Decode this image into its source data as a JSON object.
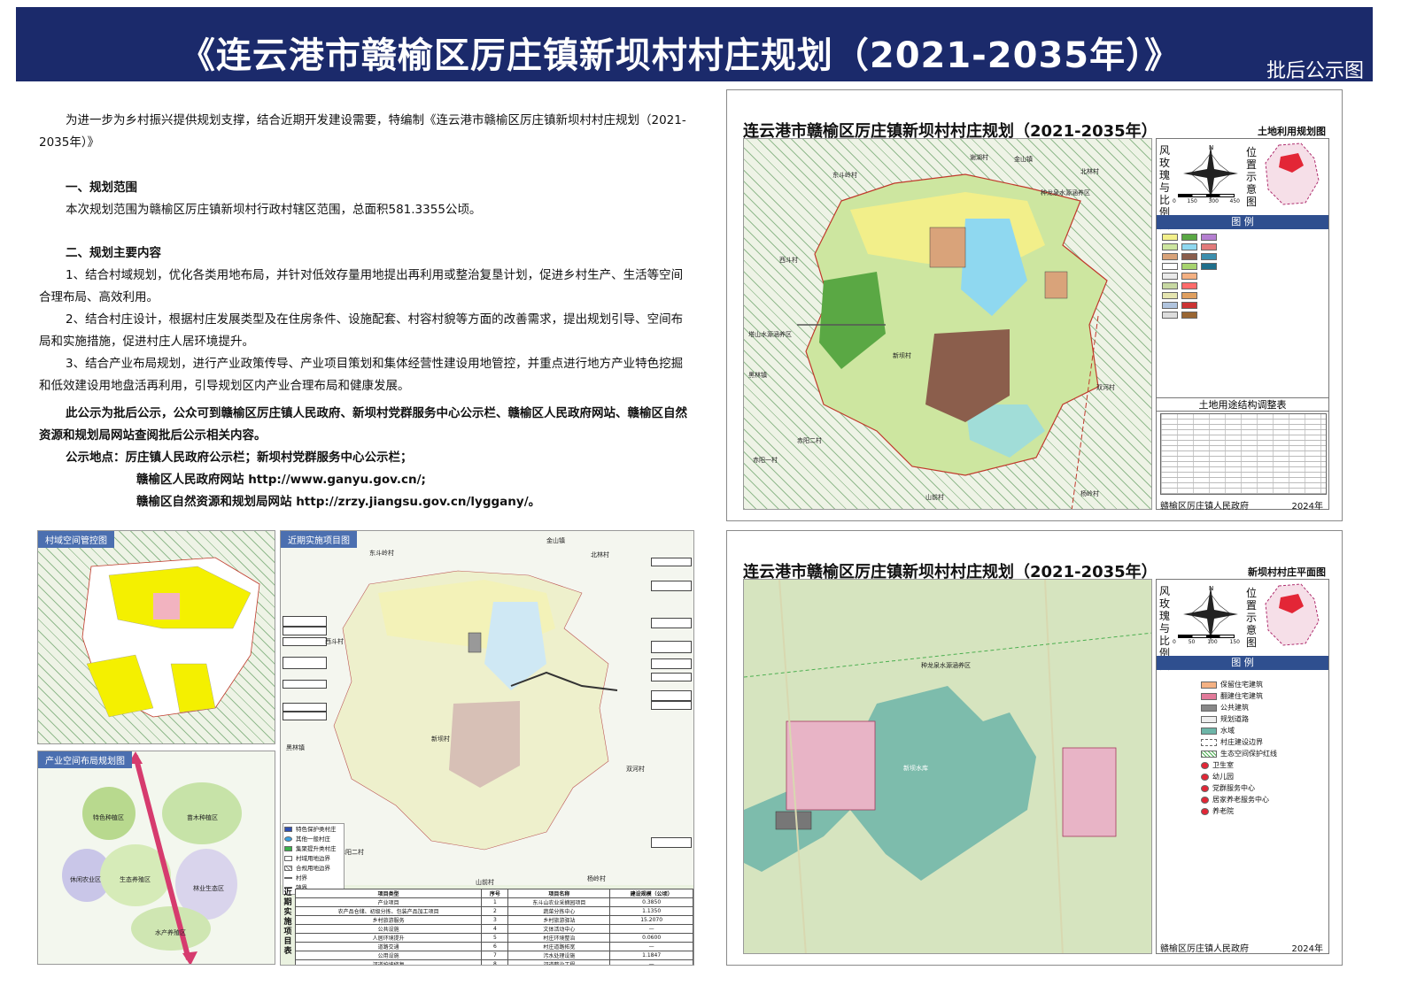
{
  "header": {
    "title": "《连云港市赣榆区厉庄镇新坝村村庄规划（2021-2035年）》",
    "subtitle": "批后公示图"
  },
  "notice": {
    "intro": "为进一步为乡村振兴提供规划支撑，结合近期开发建设需要，特编制《连云港市赣榆区厉庄镇新坝村村庄规划（2021-2035年）》",
    "sec1_title": "一、规划范围",
    "sec1_body": "本次规划范围为赣榆区厉庄镇新坝村行政村辖区范围，总面积581.3355公顷。",
    "sec2_title": "二、规划主要内容",
    "item1": "1、结合村域规划，优化各类用地布局，并针对低效存量用地提出再利用或整治复垦计划，促进乡村生产、生活等空间合理布局、高效利用。",
    "item2": "2、结合村庄设计，根据村庄发展类型及在住房条件、设施配套、村容村貌等方面的改善需求，提出规划引导、空间布局和实施措施，促进村庄人居环境提升。",
    "item3": "3、结合产业布局规划，进行产业政策传导、产业项目策划和集体经营性建设用地管控，并重点进行地方产业特色挖掘和低效建设用地盘活再利用，引导规划区内产业合理布局和健康发展。",
    "public_note": "此公示为批后公示，公众可到赣榆区厉庄镇人民政府、新坝村党群服务中心公示栏、赣榆区人民政府网站、赣榆区自然资源和规划局网站查阅批后公示相关内容。",
    "location_line": "公示地点：厉庄镇人民政府公示栏；新坝村党群服务中心公示栏；",
    "site1": "赣榆区人民政府网站 http://www.ganyu.gov.cn/;",
    "site2": "赣榆区自然资源和规划局网站 http://zrzy.jiangsu.gov.cn/lyggany/。"
  },
  "panel_landuse": {
    "title": "连云港市赣榆区厉庄镇新坝村村庄规划（2021-2035年）",
    "subtitle": "土地利用规划图",
    "compass_label": "风玫瑰与比例尺",
    "scale_ticks": [
      "0",
      "150",
      "300",
      "450"
    ],
    "location_label": "位置示意图",
    "legend_title": "图 例",
    "table_title": "土地用途结构调整表",
    "org": "赣榆区厉庄镇人民政府",
    "year": "2024年",
    "places": [
      "东斗岭村",
      "谢湖村",
      "金山镇",
      "北林村",
      "种龙泉水源涵养区",
      "西斗村",
      "塔山水源涵养区",
      "新坝村",
      "双河村",
      "黑林镇",
      "赤阳二村",
      "赤阳一村",
      "山前村",
      "杨岭村"
    ]
  },
  "panel_plan": {
    "title": "连云港市赣榆区厉庄镇新坝村村庄规划（2021-2035年）",
    "subtitle": "新坝村村庄平面图",
    "compass_label": "风玫瑰与比例尺",
    "scale_ticks": [
      "0",
      "50",
      "100",
      "150"
    ],
    "location_label": "位置示意图",
    "legend_title": "图 例",
    "legend": [
      "保留住宅建筑",
      "翻建住宅建筑",
      "公共建筑",
      "规划道路",
      "水域",
      "村庄建设边界",
      "生态空间保护红线",
      "卫生室",
      "幼儿园",
      "党群服务中心",
      "居家养老服务中心",
      "养老院"
    ],
    "places": [
      "种龙泉水源涵养区",
      "新坝水库"
    ],
    "org": "赣榆区厉庄镇人民政府",
    "year": "2024年"
  },
  "inset_control": {
    "label": "村域空间管控图"
  },
  "inset_industry": {
    "label": "产业空间布局规划图",
    "zones": [
      "特色种植区",
      "苗木种植区",
      "休闲农业区",
      "生态养殖区",
      "林业生态区",
      "水产养殖区"
    ]
  },
  "inset_projects": {
    "label": "近期实施项目图",
    "side_label": "近期实施项目表",
    "places": [
      "东斗岭村",
      "金山镇",
      "北林村",
      "西斗村",
      "新坝村",
      "双河村",
      "黑林镇",
      "赤阳二村",
      "山前村",
      "杨岭村"
    ],
    "legend": [
      "特色保护类村庄",
      "其他一般村庄",
      "集聚提升类村庄",
      "村域用地边界",
      "合规用地边界",
      "村界",
      "镇界"
    ],
    "table_head": [
      "项目类型",
      "序号",
      "项目名称",
      "建设规模（公顷）"
    ],
    "table_rows": [
      [
        "产业项目",
        "1",
        "东斗山农业采摘园项目",
        "0.3850"
      ],
      [
        "农产品仓储、初级分拣、包装产品加工项目",
        "2",
        "蔬菜分拣中心",
        "1.1350"
      ],
      [
        "乡村旅游服务",
        "3",
        "乡村旅游驿站",
        "15.2070"
      ],
      [
        "公共设施",
        "4",
        "文体活动中心",
        "—"
      ],
      [
        "人居环境提升",
        "5",
        "村庄环境整治",
        "0.0600"
      ],
      [
        "道路交通",
        "6",
        "村庄道路拓宽",
        "—"
      ],
      [
        "公用设施",
        "7",
        "污水处理设施",
        "1.1847"
      ],
      [
        "河道护坡修复",
        "8",
        "河道整治工程",
        "—"
      ],
      [
        "水利设施",
        "9",
        "灌溉设施",
        "—"
      ]
    ]
  }
}
